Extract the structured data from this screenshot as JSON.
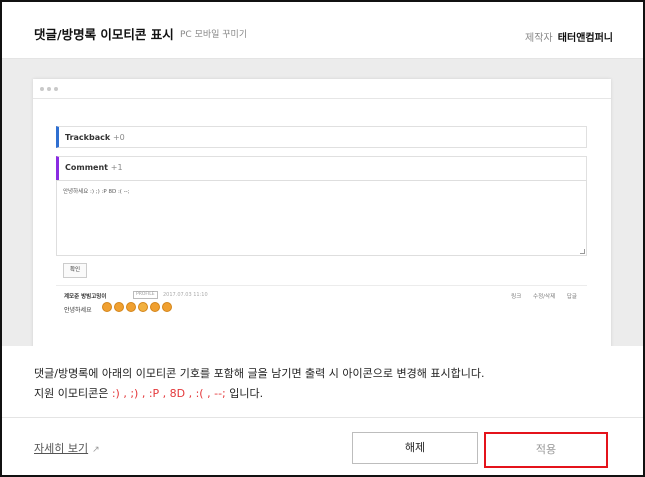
{
  "header": {
    "title": "댓글/방명록 이모티콘 표시",
    "subtitle": "PC 모바일 꾸미기",
    "maker_label": "제작자",
    "maker_name": "태터앤컴퍼니"
  },
  "preview": {
    "trackback_label": "Trackback",
    "trackback_count": "+0",
    "comment_label": "Comment",
    "comment_count": "+1",
    "textarea_value": "안녕하세요 :) ;) :P 8D :( --;",
    "confirm_button": "확인",
    "comment": {
      "author": "계모준 방빔고밍이",
      "badge": "PROFILE",
      "date": "2017.07.03 11:10",
      "actions": [
        "링크",
        "수정/삭제",
        "답글"
      ],
      "text": "안녕하세요",
      "emoji_names": [
        "smile-emoji",
        "wink-emoji",
        "tongue-emoji",
        "grin-emoji",
        "sad-emoji",
        "sweat-emoji"
      ]
    }
  },
  "description": {
    "line1": "댓글/방명록에 아래의 이모티콘 기호를 포함해 글을 남기면 출력 시 아이콘으로 변경해 표시합니다.",
    "line2_prefix": "지원 이모티콘은 ",
    "line2_emoticons": ":) , ;) , :P , 8D , :( , --;",
    "line2_suffix": " 입니다."
  },
  "footer": {
    "detail_link": "자세히 보기",
    "release_button": "해제",
    "apply_button": "적용"
  },
  "colors": {
    "trackback_accent": "#2f6fd1",
    "comment_accent": "#8a2be2",
    "emoticon_text": "#e4383b",
    "highlight_border": "#e4131b"
  }
}
